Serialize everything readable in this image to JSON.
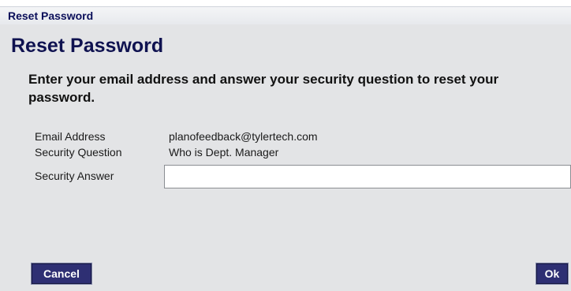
{
  "window": {
    "title": "Reset Password"
  },
  "dialog": {
    "heading": "Reset Password",
    "instructions": "Enter your email address and answer your security question to reset your password.",
    "fields": {
      "email": {
        "label": "Email Address",
        "value": "planofeedback@tylertech.com"
      },
      "question": {
        "label": "Security Question",
        "value": "Who is Dept. Manager"
      },
      "answer": {
        "label": "Security Answer",
        "value": ""
      }
    },
    "buttons": {
      "cancel": "Cancel",
      "ok": "Ok"
    }
  },
  "colors": {
    "title_text": "#0b0f5a",
    "heading_text": "#0f1250",
    "button_background": "#2e2f73",
    "dialog_background": "#e3e4e6"
  }
}
